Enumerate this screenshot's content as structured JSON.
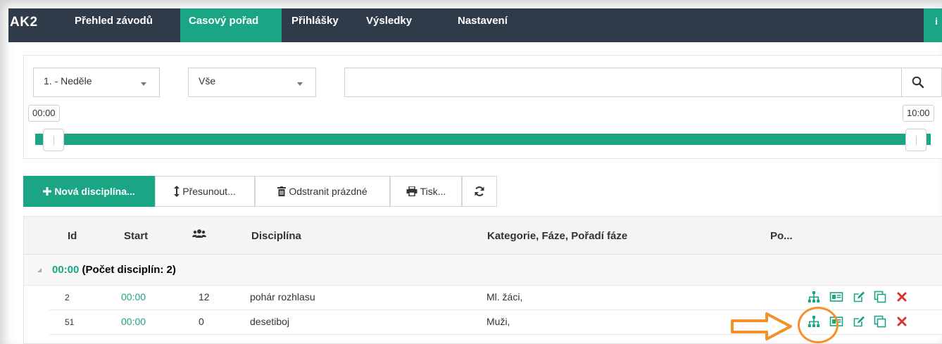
{
  "brand": "AK2",
  "nav": [
    "Přehled závodů",
    "Casový pořad",
    "Přihlášky",
    "Výsledky",
    "Nastavení"
  ],
  "nav_active": 1,
  "info_label": "i",
  "filters": {
    "day": "1. - Neděle",
    "scope": "Vše",
    "search_value": "",
    "range_min": "00:00",
    "range_max": "10:00"
  },
  "toolbar": {
    "new": "Nová disciplína...",
    "move": "Přesunout...",
    "remove_empty": "Odstranit prázdné",
    "print": "Tisk..."
  },
  "columns": {
    "id": "Id",
    "start": "Start",
    "discipline": "Disciplína",
    "category": "Kategorie, Fáze, Pořadí fáze",
    "po": "Po..."
  },
  "group": {
    "time": "00:00",
    "label": "(Počet disciplín: 2)"
  },
  "rows": [
    {
      "id": "2",
      "start": "00:00",
      "count": "12",
      "discipline": "pohár rozhlasu",
      "category": "Ml. žáci,"
    },
    {
      "id": "51",
      "start": "00:00",
      "count": "0",
      "discipline": "desetiboj",
      "category": "Muži,"
    }
  ],
  "colors": {
    "accent": "#1aa584",
    "nav_bg": "#2f3b48",
    "callout": "#f39028",
    "delete": "#d9342b"
  },
  "icons": [
    "sitemap-icon",
    "id-card-icon",
    "edit-icon",
    "copy-icon",
    "delete-icon",
    "users-icon",
    "search-icon",
    "plus-icon",
    "move-icon",
    "trash-icon",
    "print-icon",
    "refresh-icon",
    "collapse-icon"
  ]
}
